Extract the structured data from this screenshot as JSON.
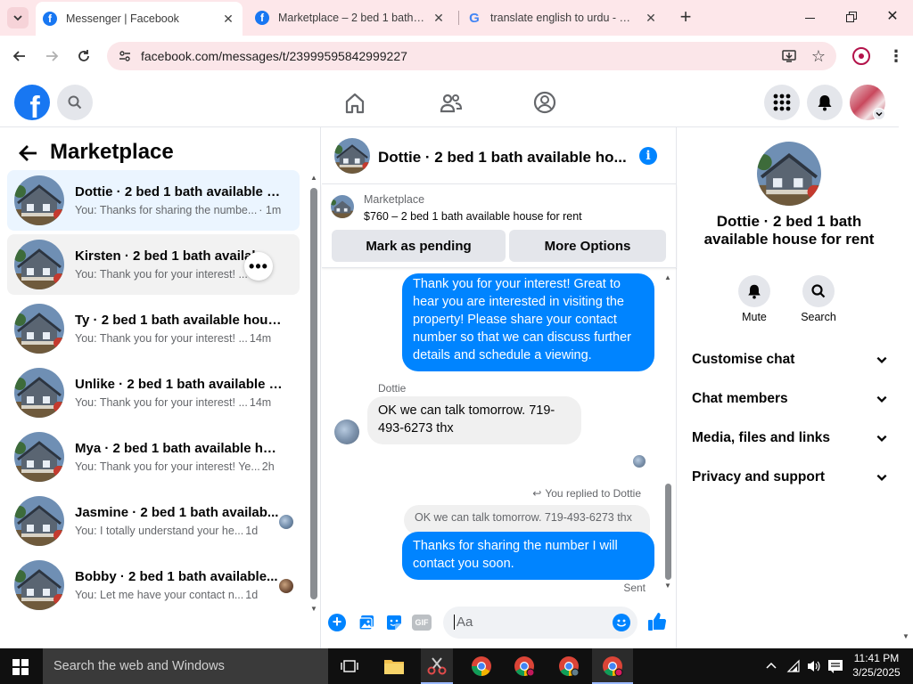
{
  "browser": {
    "tabs": [
      {
        "title": "Messenger | Facebook",
        "active": true
      },
      {
        "title": "Marketplace – 2 bed 1 bath ava",
        "active": false
      },
      {
        "title": "translate english to urdu - Goo",
        "active": false
      }
    ],
    "url": "facebook.com/messages/t/23999595842999227"
  },
  "header": {
    "logo": "f"
  },
  "sidebar": {
    "title": "Marketplace",
    "conversations": [
      {
        "name": "Dottie · 2 bed 1 bath available h...",
        "preview": "You: Thanks for sharing the numbe...",
        "time": "· 1m",
        "selected": true
      },
      {
        "name": "Kirsten · 2 bed 1 bath availab...",
        "preview": "You: Thank you for your interest! ...",
        "time": "m",
        "hovered": true
      },
      {
        "name": "Ty · 2 bed 1 bath available house...",
        "preview": "You: Thank you for your interest! ...",
        "time": "14m"
      },
      {
        "name": "Unlike · 2 bed 1 bath available h...",
        "preview": "You: Thank you for your interest! ...",
        "time": "14m"
      },
      {
        "name": "Mya · 2 bed 1 bath available hou...",
        "preview": "You: Thank you for your interest! Ye...",
        "time": "2h"
      },
      {
        "name": "Jasmine · 2 bed 1 bath availab...",
        "preview": "You: I totally understand your he...",
        "time": "1d"
      },
      {
        "name": "Bobby · 2 bed 1 bath available...",
        "preview": "You: Let me have your contact n...",
        "time": "1d"
      }
    ]
  },
  "chat": {
    "title": "Dottie · 2 bed 1 bath available ho...",
    "listing": {
      "source": "Marketplace",
      "desc": "$760 – 2 bed 1 bath available house for rent"
    },
    "actions": {
      "pending": "Mark as pending",
      "more": "More Options"
    },
    "messages": {
      "out1": "Thank you for your interest! Great to hear you are interested in visiting the property! Please share your contact number so that we can discuss further details and schedule a viewing.",
      "sender": "Dottie",
      "in1": "OK we can talk tomorrow.  719-493-6273 thx",
      "replied_label": "You replied to Dottie",
      "quoted": "OK we can talk tomorrow.  719-493-6273 thx",
      "out2": "Thanks for sharing the number I will contact you soon.",
      "status": "Sent"
    },
    "composer": {
      "placeholder": "Aa",
      "gif": "GIF"
    }
  },
  "details": {
    "name": "Dottie · 2 bed 1 bath available house for rent",
    "mute_label": "Mute",
    "search_label": "Search",
    "sections": [
      "Customise chat",
      "Chat members",
      "Media, files and links",
      "Privacy and support"
    ]
  },
  "taskbar": {
    "search_placeholder": "Search the web and Windows",
    "time": "11:41 PM",
    "date": "3/25/2025"
  },
  "colors": {
    "accent": "#0084ff",
    "brand": "#1877f2",
    "tab_strip": "#fde7ea",
    "selected_row": "#ebf5ff"
  }
}
